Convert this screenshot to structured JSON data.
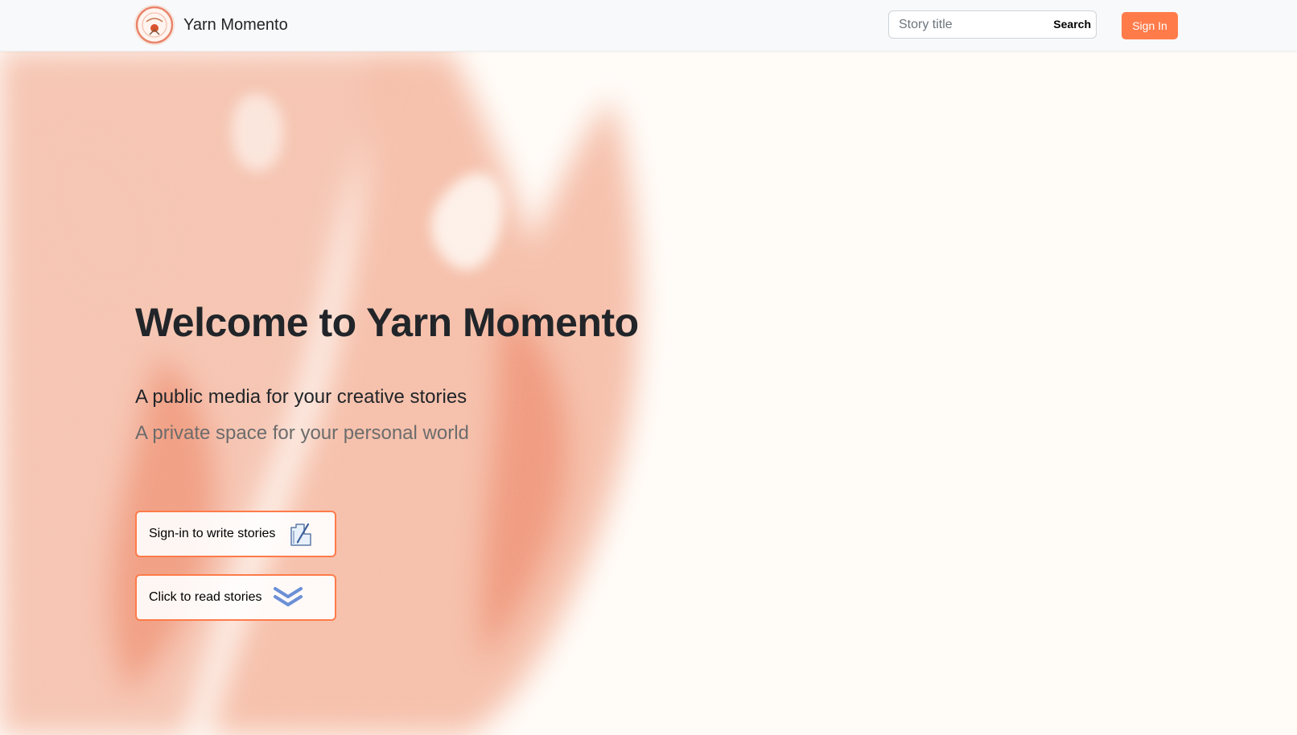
{
  "navbar": {
    "brand_name": "Yarn Momento",
    "logo_icon": "yarn-momento-logo",
    "search": {
      "placeholder": "Story title",
      "value": "",
      "button_label": "Search"
    },
    "signin_label": "Sign In"
  },
  "hero": {
    "title": "Welcome to Yarn Momento",
    "lead": "A public media for your creative stories",
    "sub": "A private space for your personal world",
    "ctas": [
      {
        "label": "Sign-in to write stories",
        "icon": "hand-writing-icon"
      },
      {
        "label": "Click to read stories",
        "icon": "double-chevron-down-icon"
      }
    ]
  },
  "colors": {
    "accent": "#ff7b4a",
    "background": "#fffcf8",
    "navbar_bg": "#f8f9fa",
    "watercolor": "#f08a68",
    "chevron": "#6b8fd6"
  }
}
